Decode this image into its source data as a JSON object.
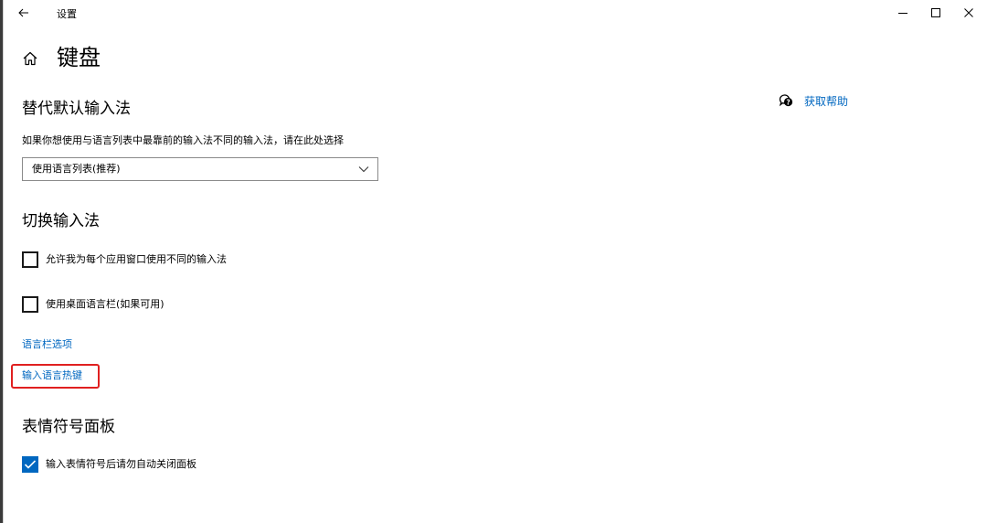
{
  "window": {
    "app_title": "设置",
    "back_icon": "arrow-left-icon",
    "controls": [
      "minimize-icon",
      "maximize-icon",
      "close-icon"
    ]
  },
  "page": {
    "title": "键盘",
    "home_icon": "home-icon"
  },
  "help": {
    "label": "获取帮助",
    "icon": "chat-help-icon"
  },
  "override_section": {
    "title": "替代默认输入法",
    "description": "如果你想使用与语言列表中最靠前的输入法不同的输入法，请在此处选择",
    "dropdown_value": "使用语言列表(推荐)"
  },
  "switch_section": {
    "title": "切换输入法",
    "checkboxes": [
      {
        "label": "允许我为每个应用窗口使用不同的输入法",
        "checked": false
      },
      {
        "label": "使用桌面语言栏(如果可用)",
        "checked": false
      }
    ],
    "links": [
      "语言栏选项",
      "输入语言热键"
    ]
  },
  "emoji_section": {
    "title": "表情符号面板",
    "checkboxes": [
      {
        "label": "输入表情符号后请勿自动关闭面板",
        "checked": true
      }
    ]
  },
  "colors": {
    "accent": "#0067c0",
    "highlight": "#e02020"
  }
}
